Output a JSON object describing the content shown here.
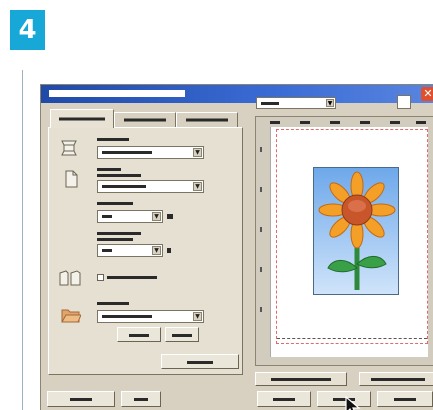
{
  "step": {
    "number": "4"
  },
  "window": {
    "close_glyph": "✕"
  },
  "icons": {
    "paper_size": "paper-size-icon",
    "orientation": "page-orientation-icon",
    "two_sided": "two-sided-icon",
    "folder": "folder-icon",
    "cursor": "mouse-cursor-icon",
    "sunflower": "sunflower-photo"
  },
  "colors": {
    "step_badge": "#17a8d8",
    "title_bar": "#1f4aa8",
    "dialog_bg": "#d8d0c0",
    "margin_line": "#e06a6a"
  }
}
